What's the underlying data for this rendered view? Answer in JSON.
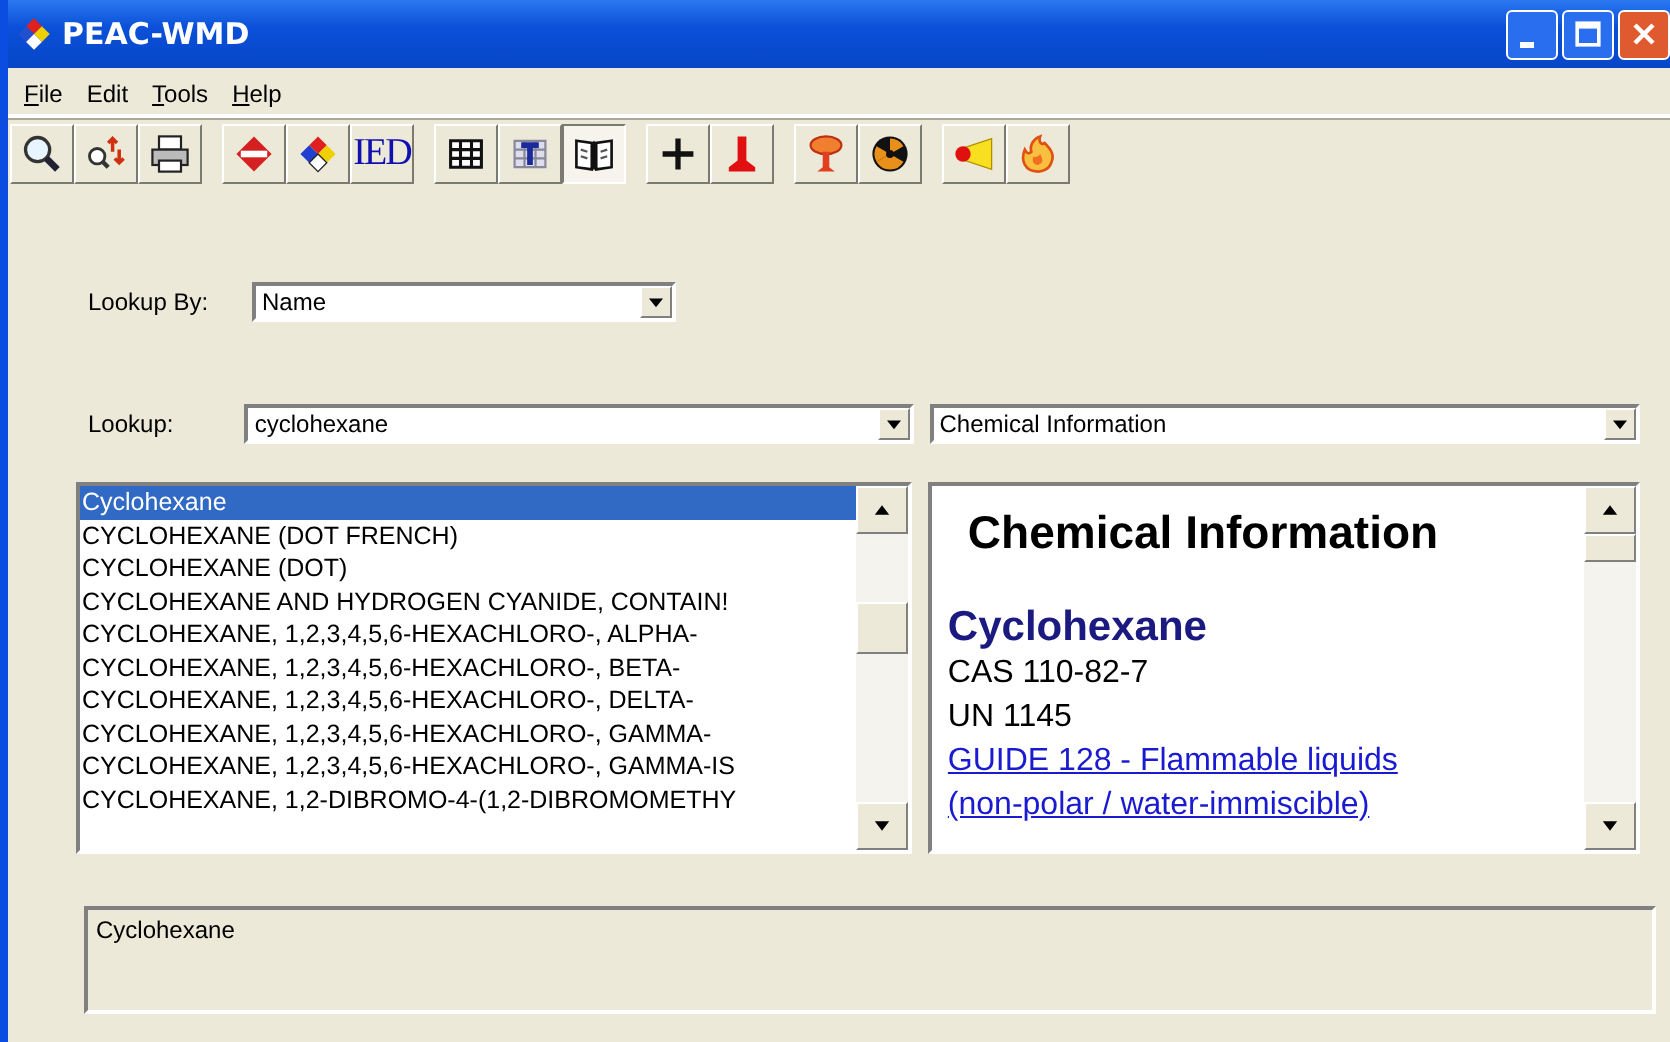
{
  "window": {
    "title": "PEAC-WMD"
  },
  "menu": [
    {
      "label": "File",
      "underline_first": true
    },
    {
      "label": "Edit",
      "underline_first": false
    },
    {
      "label": "Tools",
      "underline_first": true
    },
    {
      "label": "Help",
      "underline_first": true
    }
  ],
  "toolbar": [
    [
      {
        "kind": "search",
        "pressed": false
      },
      {
        "kind": "search-swap",
        "pressed": false
      },
      {
        "kind": "print",
        "pressed": false
      }
    ],
    [
      {
        "kind": "red-diamond",
        "pressed": false
      },
      {
        "kind": "hazard-diamond",
        "pressed": false
      },
      {
        "kind": "text",
        "label": "IED",
        "pressed": false
      }
    ],
    [
      {
        "kind": "grid",
        "pressed": false
      },
      {
        "kind": "text-grid",
        "pressed": false
      },
      {
        "kind": "book",
        "pressed": true
      }
    ],
    [
      {
        "kind": "plus",
        "pressed": false
      },
      {
        "kind": "pillar",
        "pressed": false
      }
    ],
    [
      {
        "kind": "mushroom",
        "pressed": false
      },
      {
        "kind": "radiation",
        "pressed": false
      }
    ],
    [
      {
        "kind": "megaphone",
        "pressed": false
      },
      {
        "kind": "flame",
        "pressed": false
      }
    ]
  ],
  "lookup_by": {
    "label": "Lookup By:",
    "value": "Name"
  },
  "lookup": {
    "label": "Lookup:",
    "value": "cyclohexane"
  },
  "view_select": {
    "value": "Chemical Information"
  },
  "results": [
    {
      "text": "Cyclohexane",
      "selected": true
    },
    {
      "text": "CYCLOHEXANE (DOT FRENCH)",
      "selected": false
    },
    {
      "text": "CYCLOHEXANE (DOT)",
      "selected": false
    },
    {
      "text": "CYCLOHEXANE AND HYDROGEN CYANIDE, CONTAIN!",
      "selected": false
    },
    {
      "text": "CYCLOHEXANE, 1,2,3,4,5,6-HEXACHLORO-, ALPHA-",
      "selected": false
    },
    {
      "text": "CYCLOHEXANE, 1,2,3,4,5,6-HEXACHLORO-, BETA-",
      "selected": false
    },
    {
      "text": "CYCLOHEXANE, 1,2,3,4,5,6-HEXACHLORO-, DELTA-",
      "selected": false
    },
    {
      "text": "CYCLOHEXANE, 1,2,3,4,5,6-HEXACHLORO-, GAMMA-",
      "selected": false
    },
    {
      "text": "CYCLOHEXANE, 1,2,3,4,5,6-HEXACHLORO-, GAMMA-IS",
      "selected": false
    },
    {
      "text": "CYCLOHEXANE, 1,2-DIBROMO-4-(1,2-DIBROMOMETHY",
      "selected": false
    }
  ],
  "info": {
    "heading": "Chemical Information",
    "name": "Cyclohexane",
    "lines": [
      "CAS 110-82-7",
      "UN 1145"
    ],
    "links": [
      "GUIDE 128 - Flammable liquids",
      "(non-polar / water-immiscible)"
    ]
  },
  "details": {
    "text": "Cyclohexane"
  }
}
